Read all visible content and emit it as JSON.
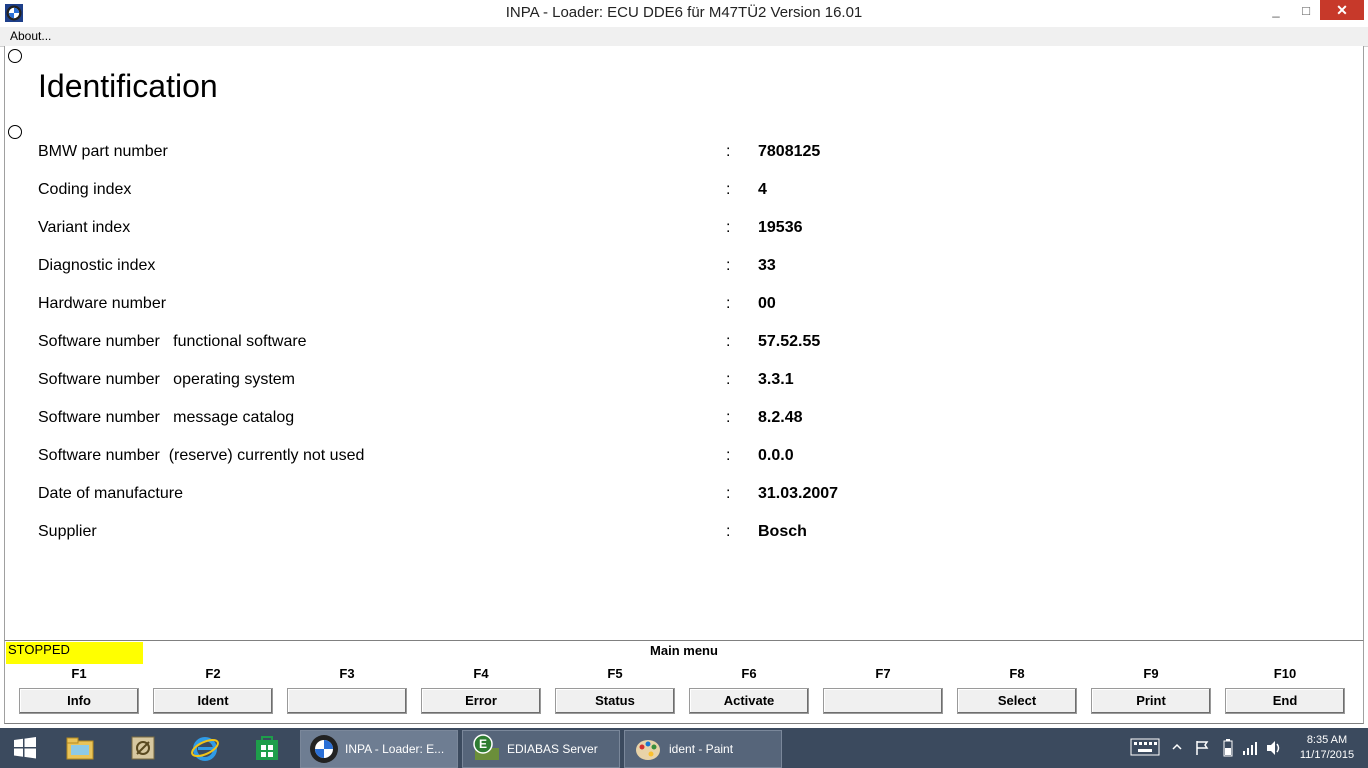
{
  "window": {
    "title": "INPA - Loader:  ECU DDE6 für M47TÜ2 Version 16.01",
    "controls": {
      "minimize": "_",
      "maximize": "□",
      "close": "✕"
    }
  },
  "menu": {
    "about": "About..."
  },
  "main": {
    "heading": "Identification",
    "rows": [
      {
        "label": "BMW part number",
        "value": "7808125"
      },
      {
        "label": "Coding index",
        "value": "4"
      },
      {
        "label": "Variant index",
        "value": "19536"
      },
      {
        "label": "Diagnostic index",
        "value": "33"
      },
      {
        "label": "Hardware number",
        "value": "00"
      },
      {
        "label": "Software number   functional software",
        "value": "57.52.55"
      },
      {
        "label": "Software number   operating system",
        "value": "3.3.1"
      },
      {
        "label": "Software number   message catalog",
        "value": "8.2.48"
      },
      {
        "label": "Software number  (reserve) currently not used",
        "value": "0.0.0"
      },
      {
        "label": "Date of manufacture",
        "value": "31.03.2007"
      },
      {
        "label": "Supplier",
        "value": "Bosch"
      }
    ],
    "colon": ":"
  },
  "status": {
    "state": "STOPPED",
    "menu_title": "Main menu",
    "state_color": "#ffff00"
  },
  "function_keys": [
    {
      "key": "F1",
      "label": "Info"
    },
    {
      "key": "F2",
      "label": "Ident"
    },
    {
      "key": "F3",
      "label": ""
    },
    {
      "key": "F4",
      "label": "Error"
    },
    {
      "key": "F5",
      "label": "Status"
    },
    {
      "key": "F6",
      "label": "Activate"
    },
    {
      "key": "F7",
      "label": ""
    },
    {
      "key": "F8",
      "label": "Select"
    },
    {
      "key": "F9",
      "label": "Print"
    },
    {
      "key": "F10",
      "label": "End"
    }
  ],
  "taskbar": {
    "tasks": [
      {
        "label": "INPA - Loader:  E...",
        "icon": "bmw-logo-icon"
      },
      {
        "label": "EDIABAS Server",
        "icon": "ediabas-icon"
      },
      {
        "label": "ident - Paint",
        "icon": "paint-icon"
      }
    ],
    "clock": {
      "time": "8:35 AM",
      "date": "11/17/2015"
    }
  },
  "colors": {
    "close_button": "#c7392a",
    "taskbar": "#3b4a5e",
    "status_stopped": "#ffff00"
  }
}
